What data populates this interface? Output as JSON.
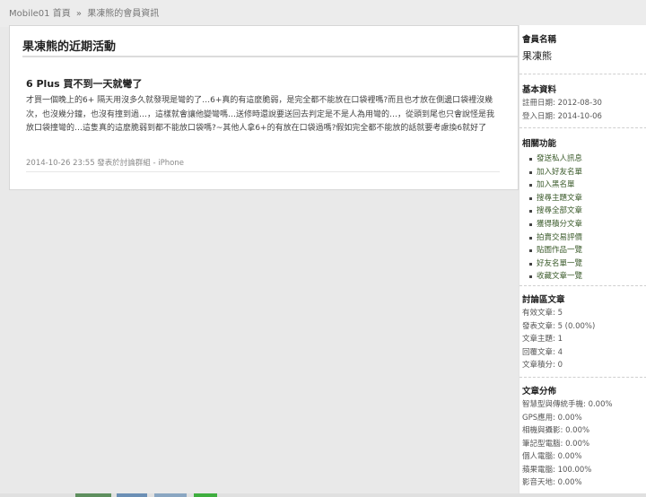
{
  "breadcrumb": {
    "root": "Mobile01",
    "home": "首頁",
    "sep": "»",
    "current": "果凍熊的會員資訊"
  },
  "main": {
    "title": "果凍熊的近期活動",
    "article": {
      "title": "6 Plus 買不到一天就彎了",
      "body": "才買一個晚上的6+ 隔天用沒多久就發現是彎的了…6+真的有這麼脆弱，是完全都不能放在口袋裡嗎?而且也才放在側邊口袋裡沒幾次，也沒幾分鐘，也沒有撞到過…，這樣就會讓他變彎嗎…送修時還說要送回去判定是不是人為用彎的…，從頭到尾也只會說怪是我放口袋撞彎的…這隻真的這麼脆弱到都不能放口袋嗎?~其他人拿6+的有放在口袋過嗎?假如完全都不能放的話就要考慮換6就好了",
      "meta": "2014-10-26 23:55 發表於討論群組 - iPhone"
    }
  },
  "sidebar": {
    "member": {
      "heading": "會員名稱",
      "name": "果凍熊"
    },
    "basic": {
      "heading": "基本資料",
      "register": "註冊日期: 2012-08-30",
      "login": "登入日期: 2014-10-06"
    },
    "functions": {
      "heading": "相關功能",
      "items": [
        "發送私人訊息",
        "加入好友名單",
        "加入黑名單",
        "搜尋主題文章",
        "搜尋全部文章",
        "獲得積分文章",
        "拍賣交易評價",
        "貼圖作品一覽",
        "好友名單一覽",
        "收藏文章一覽"
      ]
    },
    "forum": {
      "heading": "討論區文章",
      "lines": [
        "有效文章: 5",
        "發表文章: 5 (0.00%)",
        "文章主題: 1",
        "回覆文章: 4",
        "文章積分: 0"
      ]
    },
    "distribution": {
      "heading": "文章分佈",
      "lines": [
        "智慧型與傳統手機: 0.00%",
        "GPS應用: 0.00%",
        "相機與攝影: 0.00%",
        "筆記型電腦: 0.00%",
        "個人電腦: 0.00%",
        "蘋果電腦: 100.00%",
        "影音天地: 0.00%"
      ]
    }
  },
  "colors": {
    "link": "#3a5a2a",
    "panel_bg": "#ffffff",
    "page_bg": "#e9e9e9"
  }
}
